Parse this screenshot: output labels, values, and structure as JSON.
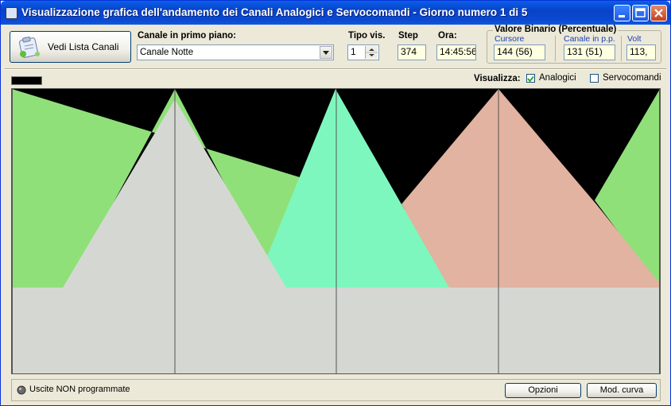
{
  "window": {
    "title": "Visualizzazione grafica dell'andamento dei Canali Analogici e Servocomandi - Giorno numero 1 di 5"
  },
  "toolbar": {
    "vedi_lista_label": "Vedi Lista Canali",
    "canale_label": "Canale in primo piano:",
    "canale_value": "Canale Notte",
    "tipo_label": "Tipo vis.",
    "tipo_value": "1",
    "step_label": "Step",
    "step_value": "374",
    "ora_label": "Ora:",
    "ora_value": "14:45:56"
  },
  "valore": {
    "group_label": "Valore Binario (Percentuale)",
    "cursore_label": "Cursore",
    "cursore_value": "144  (56)",
    "canale_pp_label": "Canale in p.p.",
    "canale_pp_value": "131  (51)",
    "volt_label": "Volt",
    "volt_value": "113,"
  },
  "visualizza": {
    "label": "Visualizza:",
    "analogici_label": "Analogici",
    "analogici_checked": true,
    "servocomandi_label": "Servocomandi",
    "servocomandi_checked": false
  },
  "status": {
    "led_label": "Uscite NON programmate"
  },
  "buttons": {
    "opzioni": "Opzioni",
    "mod_curva": "Mod. curva"
  },
  "colors": {
    "title_bar": "#0a49d0",
    "graph_background": "#000000",
    "series_green": "#90e07a",
    "series_mint": "#7ef7be",
    "series_salmon": "#e1b3a0",
    "series_gray": "#d5d8d2",
    "field_yellow": "#ffffe1"
  },
  "icons": {
    "app": "app-icon",
    "vedi_lista": "clipboard-list-icon",
    "dropdown": "chevron-down-icon",
    "spin": "spin-arrows-icon",
    "minimize": "minimize-icon",
    "maximize": "maximize-icon",
    "close": "close-icon",
    "led": "led-icon"
  }
}
